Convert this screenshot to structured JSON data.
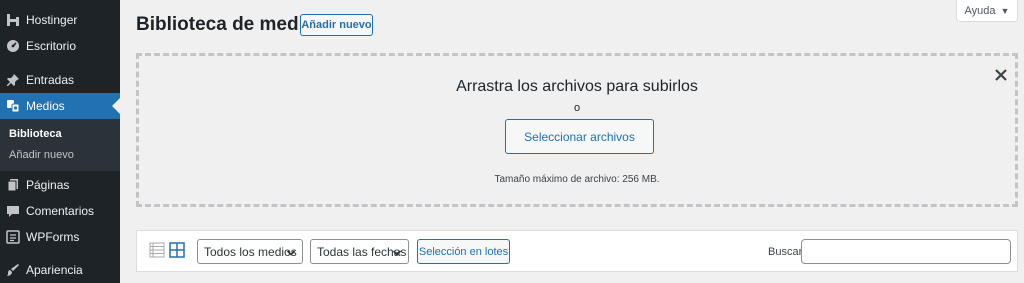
{
  "sidebar": {
    "items": [
      {
        "label": "Hostinger",
        "icon": "hostinger-icon"
      },
      {
        "label": "Escritorio",
        "icon": "dashboard-icon"
      },
      {
        "label": "Entradas",
        "icon": "pin-icon"
      },
      {
        "label": "Medios",
        "icon": "media-icon",
        "active": true
      },
      {
        "label": "Páginas",
        "icon": "pages-icon"
      },
      {
        "label": "Comentarios",
        "icon": "comments-icon"
      },
      {
        "label": "WPForms",
        "icon": "wpforms-icon"
      },
      {
        "label": "Apariencia",
        "icon": "appearance-icon"
      }
    ],
    "submenu": [
      {
        "label": "Biblioteca",
        "current": true
      },
      {
        "label": "Añadir nuevo",
        "current": false
      }
    ]
  },
  "header": {
    "title": "Biblioteca de medios",
    "add_new_label": "Añadir nuevo",
    "help_label": "Ayuda"
  },
  "upload": {
    "title": "Arrastra los archivos para subirlos",
    "or": "o",
    "select_label": "Seleccionar archivos",
    "max_size": "Tamaño máximo de archivo: 256 MB."
  },
  "toolbar": {
    "media_filter": "Todos los medios",
    "date_filter": "Todas las fechas",
    "bulk_label": "Selección en lotes",
    "search_label": "Buscar",
    "search_value": ""
  },
  "colors": {
    "sidebar_bg": "#1d2327",
    "accent": "#2271b1",
    "page_bg": "#f0f0f1"
  }
}
